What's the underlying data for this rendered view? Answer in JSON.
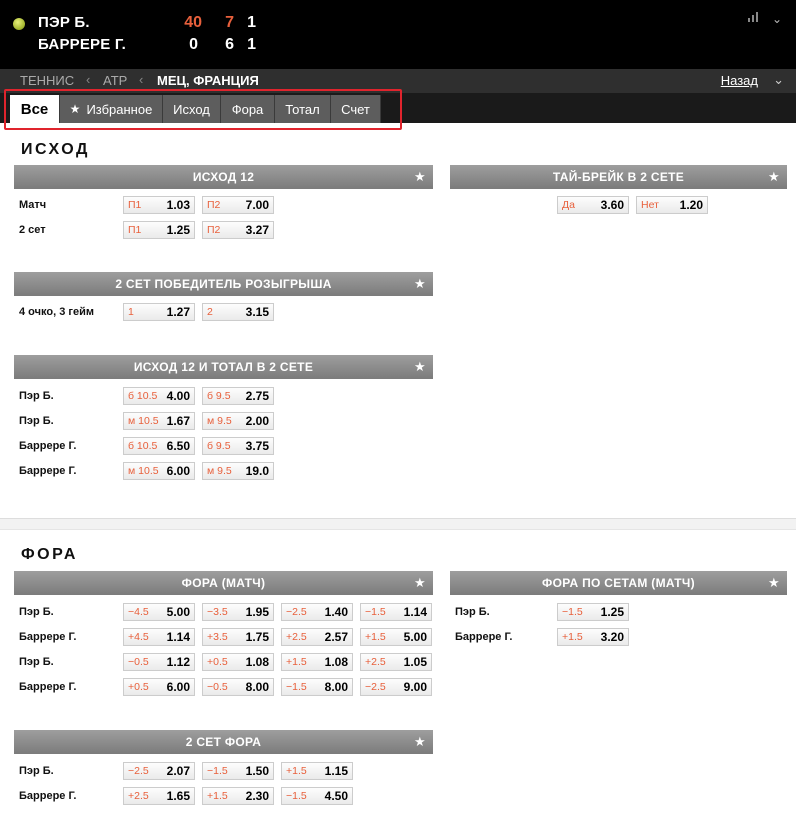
{
  "scoreboard": {
    "players": [
      {
        "name": "ПЭР Б.",
        "game": "40",
        "set2": "7",
        "sets": "1"
      },
      {
        "name": "БАРРЕРЕ Г.",
        "game": "0",
        "set2": "6",
        "sets": "1"
      }
    ],
    "icons": [
      "ball-icon",
      "bar-chart-icon",
      "chevron-down-icon"
    ]
  },
  "breadcrumb": {
    "items": [
      "ТЕННИС",
      "ATP",
      "МЕЦ, ФРАНЦИЯ"
    ],
    "back": "Назад"
  },
  "tabs": [
    {
      "label": "Все",
      "active": true
    },
    {
      "label": "Избранное",
      "icon": "star-icon"
    },
    {
      "label": "Исход"
    },
    {
      "label": "Фора"
    },
    {
      "label": "Тотал"
    },
    {
      "label": "Счет"
    }
  ],
  "sections": {
    "outcome": {
      "title": "ИСХОД",
      "blocks": {
        "ishod12": {
          "title": "ИСХОД 12",
          "rows": [
            {
              "label": "Матч",
              "odds": [
                {
                  "k": "П1",
                  "v": "1.03"
                },
                {
                  "k": "П2",
                  "v": "7.00"
                }
              ]
            },
            {
              "label": "2 сет",
              "odds": [
                {
                  "k": "П1",
                  "v": "1.25"
                },
                {
                  "k": "П2",
                  "v": "3.27"
                }
              ]
            }
          ]
        },
        "tiebreak": {
          "title": "ТАЙ-БРЕЙК В 2 СЕТЕ",
          "rows": [
            {
              "label": "",
              "odds": [
                {
                  "k": "Да",
                  "v": "3.60"
                },
                {
                  "k": "Нет",
                  "v": "1.20"
                }
              ]
            }
          ]
        },
        "point_winner": {
          "title": "2 СЕТ ПОБЕДИТЕЛЬ РОЗЫГРЫША",
          "rows": [
            {
              "label": "4 очко, 3 гейм",
              "odds": [
                {
                  "k": "1",
                  "v": "1.27"
                },
                {
                  "k": "2",
                  "v": "3.15"
                }
              ]
            }
          ]
        },
        "ishod_total": {
          "title": "ИСХОД 12 И ТОТАЛ В 2 СЕТЕ",
          "rows": [
            {
              "label": "Пэр Б.",
              "odds": [
                {
                  "k": "б 10.5",
                  "v": "4.00"
                },
                {
                  "k": "б 9.5",
                  "v": "2.75"
                }
              ]
            },
            {
              "label": "Пэр Б.",
              "odds": [
                {
                  "k": "м 10.5",
                  "v": "1.67"
                },
                {
                  "k": "м 9.5",
                  "v": "2.00"
                }
              ]
            },
            {
              "label": "Баррере Г.",
              "odds": [
                {
                  "k": "б 10.5",
                  "v": "6.50"
                },
                {
                  "k": "б 9.5",
                  "v": "3.75"
                }
              ]
            },
            {
              "label": "Баррере Г.",
              "odds": [
                {
                  "k": "м 10.5",
                  "v": "6.00"
                },
                {
                  "k": "м 9.5",
                  "v": "19.0"
                }
              ]
            }
          ]
        }
      }
    },
    "handicap": {
      "title": "ФОРА",
      "blocks": {
        "match": {
          "title": "ФОРА (МАТЧ)",
          "rows": [
            {
              "label": "Пэр Б.",
              "odds": [
                {
                  "k": "−4.5",
                  "v": "5.00"
                },
                {
                  "k": "−3.5",
                  "v": "1.95"
                },
                {
                  "k": "−2.5",
                  "v": "1.40"
                },
                {
                  "k": "−1.5",
                  "v": "1.14"
                }
              ]
            },
            {
              "label": "Баррере Г.",
              "odds": [
                {
                  "k": "+4.5",
                  "v": "1.14"
                },
                {
                  "k": "+3.5",
                  "v": "1.75"
                },
                {
                  "k": "+2.5",
                  "v": "2.57"
                },
                {
                  "k": "+1.5",
                  "v": "5.00"
                }
              ]
            },
            {
              "label": "Пэр Б.",
              "odds": [
                {
                  "k": "−0.5",
                  "v": "1.12"
                },
                {
                  "k": "+0.5",
                  "v": "1.08"
                },
                {
                  "k": "+1.5",
                  "v": "1.08"
                },
                {
                  "k": "+2.5",
                  "v": "1.05"
                }
              ]
            },
            {
              "label": "Баррере Г.",
              "odds": [
                {
                  "k": "+0.5",
                  "v": "6.00"
                },
                {
                  "k": "−0.5",
                  "v": "8.00"
                },
                {
                  "k": "−1.5",
                  "v": "8.00"
                },
                {
                  "k": "−2.5",
                  "v": "9.00"
                }
              ]
            }
          ]
        },
        "sets": {
          "title": "ФОРА ПО СЕТАМ (МАТЧ)",
          "rows": [
            {
              "label": "Пэр Б.",
              "odds": [
                {
                  "k": "−1.5",
                  "v": "1.25"
                }
              ]
            },
            {
              "label": "Баррере Г.",
              "odds": [
                {
                  "k": "+1.5",
                  "v": "3.20"
                }
              ]
            }
          ]
        },
        "set2": {
          "title": "2 СЕТ ФОРА",
          "rows": [
            {
              "label": "Пэр Б.",
              "odds": [
                {
                  "k": "−2.5",
                  "v": "2.07"
                },
                {
                  "k": "−1.5",
                  "v": "1.50"
                },
                {
                  "k": "+1.5",
                  "v": "1.15"
                }
              ]
            },
            {
              "label": "Баррере Г.",
              "odds": [
                {
                  "k": "+2.5",
                  "v": "1.65"
                },
                {
                  "k": "+1.5",
                  "v": "2.30"
                },
                {
                  "k": "−1.5",
                  "v": "4.50"
                }
              ]
            }
          ]
        }
      }
    }
  },
  "colors": {
    "accent": "#e8603c",
    "highlight": "#e0242d",
    "header_bg": "#000000"
  }
}
